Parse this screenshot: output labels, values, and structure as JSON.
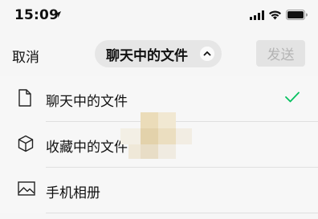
{
  "status_bar": {
    "time": "15:09"
  },
  "nav": {
    "cancel_label": "取消",
    "title": "聊天中的文件",
    "send_label": "发送"
  },
  "menu": {
    "items": [
      {
        "label": "聊天中的文件",
        "icon": "document-icon",
        "selected": true
      },
      {
        "label": "收藏中的文件",
        "icon": "cube-icon",
        "selected": false
      },
      {
        "label": "手机相册",
        "icon": "photo-icon",
        "selected": false
      }
    ]
  },
  "colors": {
    "accent_check": "#07c160",
    "send_button_bg": "#e3e3e3",
    "pill_bg": "#e6e6e6"
  }
}
